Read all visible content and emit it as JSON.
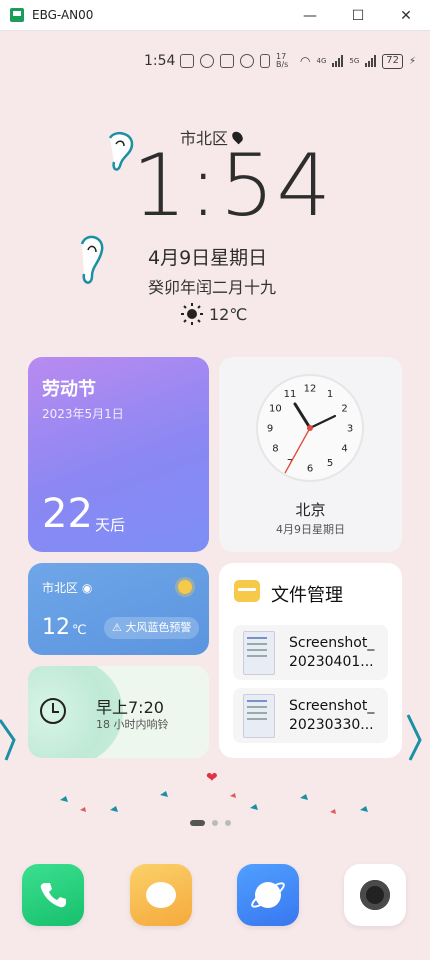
{
  "window": {
    "title": "EBG-AN00",
    "minimize": "—",
    "maximize": "☐",
    "close": "✕"
  },
  "status_bar": {
    "time": "1:54",
    "net_speed": "17 B/s",
    "signal1": "4G",
    "signal2": "5G",
    "battery": "72"
  },
  "lockscreen": {
    "location": "市北区",
    "time": "1:54",
    "date": "4月9日星期日",
    "lunar": "癸卯年闰二月十九",
    "temperature": "12℃"
  },
  "holiday_widget": {
    "title": "劳动节",
    "date": "2023年5月1日",
    "days": "22",
    "unit": "天后"
  },
  "clock_widget": {
    "city": "北京",
    "date": "4月9日星期日",
    "numbers": [
      "12",
      "1",
      "2",
      "3",
      "4",
      "5",
      "6",
      "7",
      "8",
      "9",
      "10",
      "11"
    ]
  },
  "weather_widget": {
    "location": "市北区",
    "temp": "12",
    "unit": "℃",
    "alert": "⚠ 大风蓝色预警"
  },
  "alarm_widget": {
    "time": "早上7:20",
    "subtitle": "18 小时内响铃"
  },
  "file_widget": {
    "title": "文件管理",
    "files": [
      {
        "line1": "Screenshot_",
        "line2": "20230401..."
      },
      {
        "line1": "Screenshot_",
        "line2": "20230330..."
      }
    ]
  },
  "page_indicator": {
    "count": 3,
    "active": 0
  },
  "dock": [
    "phone",
    "messages",
    "browser",
    "camera"
  ]
}
